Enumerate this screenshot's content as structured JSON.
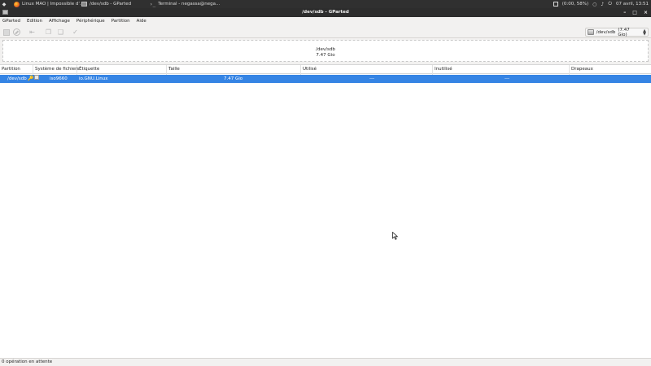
{
  "top_panel": {
    "tasks": [
      {
        "label": "Linux MAO | Impossible d'..."
      },
      {
        "label": "/dev/sdb - GParted"
      },
      {
        "label": "Terminal - negassa@nega..."
      }
    ],
    "battery": "(0:00, 58%)",
    "datetime": "07 avril, 13:51"
  },
  "window": {
    "title": "/dev/sdb - GParted"
  },
  "menubar": {
    "items": [
      "GParted",
      "Edition",
      "Affichage",
      "Périphérique",
      "Partition",
      "Aide"
    ]
  },
  "toolbar": {
    "device_name": "/dev/sdb",
    "device_size": "(7.47 Gio)"
  },
  "visualizer": {
    "device": "/dev/sdb",
    "size": "7.47 Gio"
  },
  "table": {
    "columns": [
      "Partition",
      "Système de fichiers",
      "Étiquette",
      "Taille",
      "Utilisé",
      "Inutilisé",
      "Drapeaux"
    ],
    "rows": [
      {
        "partition": "/dev/sdb",
        "filesystem": "iso9660",
        "label": "io.GNU.Linux",
        "size": "7.47 Gio",
        "used": "---",
        "unused": "---",
        "flags": ""
      }
    ]
  },
  "statusbar": {
    "text": "0 opération en attente"
  }
}
